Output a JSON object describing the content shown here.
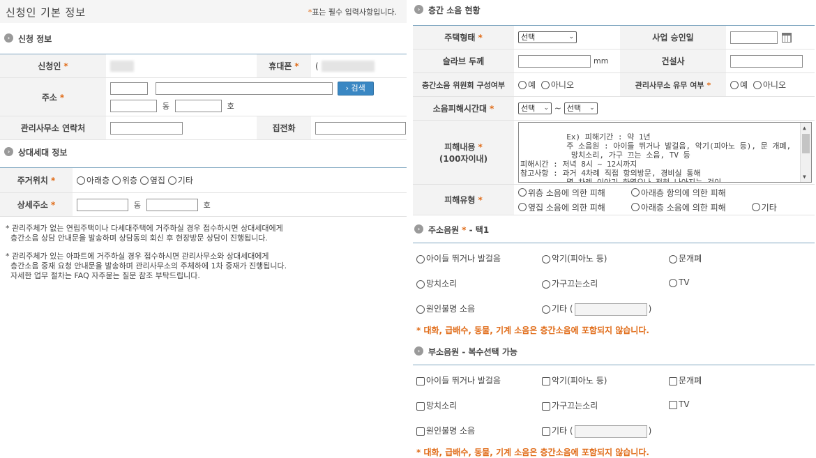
{
  "header": {
    "title": "신청인 기본 정보",
    "required_mark": "*",
    "required_note": "표는 필수 입력사항입니다."
  },
  "applicant_section": {
    "title": "신청 정보",
    "applicant_label": "신청인",
    "mobile_label": "휴대폰",
    "mobile_partial": "(",
    "address_label": "주소",
    "search_button": "› 검색",
    "dong_unit": "동",
    "ho_unit": "호",
    "management_contact_label": "관리사무소 연락처",
    "home_phone_label": "집전화"
  },
  "neighbor_section": {
    "title": "상대세대 정보",
    "location_label": "주거위치",
    "location_options": [
      "아래층",
      "위층",
      "옆집",
      "기타"
    ],
    "detail_address_label": "상세주소",
    "dong_unit": "동",
    "ho_unit": "호"
  },
  "notes": [
    "* 관리주체가 없는 연립주택이나 다세대주택에 거주하실 경우 접수하시면 상대세대에게\n  층간소음 상담 안내문을 발송하며 상담동의 회신 후 현장방문 상담이 진행됩니다.",
    "* 관리주체가 있는 아파트에 거주하실 경우 접수하시면 관리사무소와 상대세대에게\n  층간소음 중재 요청 안내문을 발송하며 관리사무소의 주체하에 1차 중재가 진행됩니다.\n  자세한 업무 절차는 FAQ 자주묻는 질문 참조 부탁드립니다."
  ],
  "status_section": {
    "title": "층간 소음 현황",
    "housing_type_label": "주택형태",
    "housing_type_value": "선택",
    "approval_date_label": "사업 승인일",
    "slab_label": "슬라브 두께",
    "slab_unit": "mm",
    "builder_label": "건설사",
    "committee_label": "층간소음 위원회 구성여부",
    "office_label": "관리사무소 유무 여부",
    "yes": "예",
    "no": "아니오",
    "time_label": "소음피해시간대",
    "time_from": "선택",
    "time_sep": "~",
    "time_to": "선택",
    "damage_label": "피해내용",
    "damage_sub": "(100자이내)",
    "damage_placeholder": "Ex) 피해기간 : 약 1년\n          주 소음원 : 아이들 뛰거나 발걸음, 악기(피아노 등), 문 개폐,\n           망치소리, 가구 끄는 소음, TV 등\n피해시간 : 저녁 8시 ~ 12시까지\n참고사항 : 과거 4차례 직접 항의방문, 경비실 통해\n          몇 차례 이야기 하였으나 전혀 나아지는 것이",
    "damage_type_label": "피해유형",
    "damage_types": [
      "위층 소음에 의한 피해",
      "아래층 항의에 의한 피해",
      "옆집 소음에 의한 피해",
      "아래층 소음에 의한 피해",
      "기타"
    ]
  },
  "main_noise": {
    "title": "주소음원",
    "suffix": "- 택1",
    "options": [
      "아이들 뛰거나 발걸음",
      "악기(피아노 등)",
      "문개폐",
      "망치소리",
      "가구끄는소리",
      "TV",
      "원인불명 소음",
      "기타 ("
    ],
    "close_paren": ")",
    "warning": "* 대화, 급배수, 동물, 기계 소음은 층간소음에 포함되지 않습니다."
  },
  "sub_noise": {
    "title": "부소음원 - 복수선택 가능",
    "options": [
      "아이들 뛰거나 발걸음",
      "악기(피아노 등)",
      "문개폐",
      "망치소리",
      "가구끄는소리",
      "TV",
      "원인불명 소음",
      "기타 ("
    ],
    "close_paren": ")",
    "warning": "* 대화, 급배수, 동물, 기계 소음은 층간소음에 포함되지 않습니다."
  },
  "icons": {
    "section_bullet": "circle-arrow-icon",
    "calendar": "calendar-icon"
  },
  "colors": {
    "accent": "#e06b17",
    "button": "#3a87c3",
    "table_border": "#7fa6c0"
  }
}
